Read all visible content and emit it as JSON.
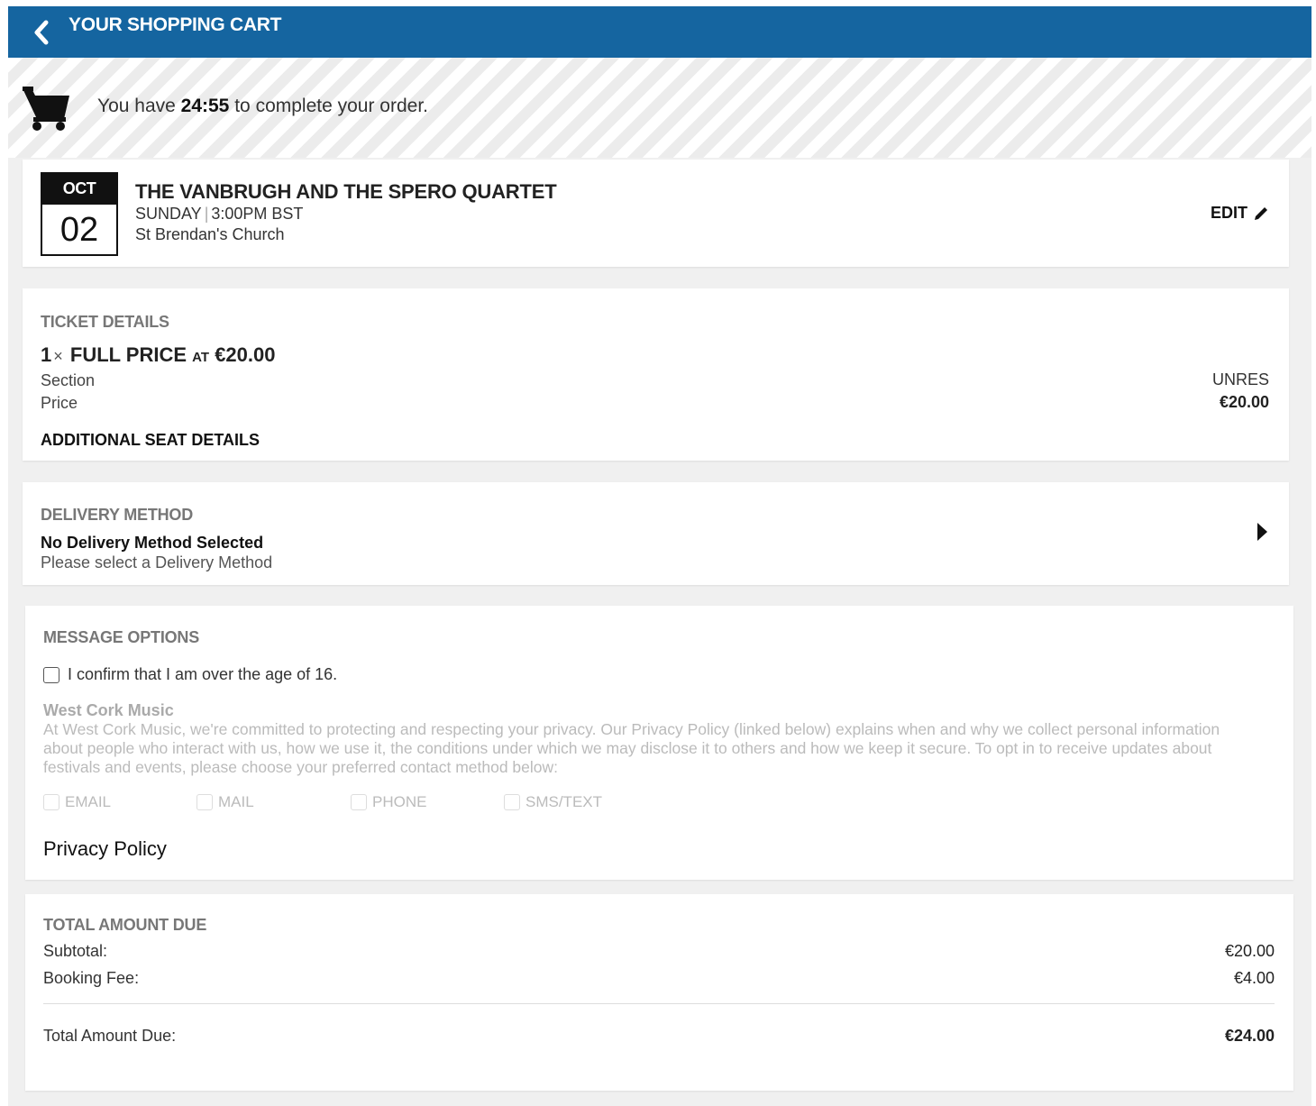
{
  "header": {
    "title": "YOUR SHOPPING CART",
    "back_icon": "chevron-left-icon"
  },
  "timer": {
    "prefix": "You have",
    "time": "24:55",
    "suffix": "to complete your order.",
    "icon": "cart-icon"
  },
  "event": {
    "month": "OCT",
    "day": "02",
    "title": "THE VANBRUGH AND THE SPERO QUARTET",
    "weekday": "SUNDAY",
    "separator": "|",
    "time": "3:00PM BST",
    "venue": "St Brendan's Church",
    "edit_label": "EDIT",
    "edit_icon": "pencil-icon"
  },
  "ticket": {
    "section_title": "TICKET DETAILS",
    "quantity": "1",
    "times": "×",
    "type": "FULL PRICE",
    "at": "AT",
    "price": "€20.00",
    "section_label": "Section",
    "section_value": "UNRES",
    "price_label": "Price",
    "price_value": "€20.00",
    "additional_label": "ADDITIONAL SEAT DETAILS"
  },
  "delivery": {
    "section_title": "DELIVERY METHOD",
    "status": "No Delivery Method Selected",
    "hint": "Please select a Delivery Method",
    "arrow_icon": "caret-right-icon"
  },
  "message": {
    "section_title": "MESSAGE OPTIONS",
    "confirm_label": "I confirm that I am over the age of 16.",
    "org_name": "West Cork Music",
    "org_desc": "At West Cork Music, we're committed to protecting and respecting your privacy. Our Privacy Policy (linked below) explains when and why we collect personal information about people who interact with us, how we use it, the conditions under which we may disclose it to others and how we keep it secure. To opt in to receive updates about festivals and events, please choose your preferred contact method below:",
    "options": [
      "EMAIL",
      "MAIL",
      "PHONE",
      "SMS/TEXT"
    ],
    "privacy_label": "Privacy Policy"
  },
  "totals": {
    "section_title": "TOTAL AMOUNT DUE",
    "subtotal_label": "Subtotal:",
    "subtotal_value": "€20.00",
    "fee_label": "Booking Fee:",
    "fee_value": "€4.00",
    "total_label": "Total Amount Due:",
    "total_value": "€24.00"
  },
  "colors": {
    "header_bg": "#1565a0",
    "page_bg": "#f0f0f0",
    "card_bg": "#ffffff"
  }
}
